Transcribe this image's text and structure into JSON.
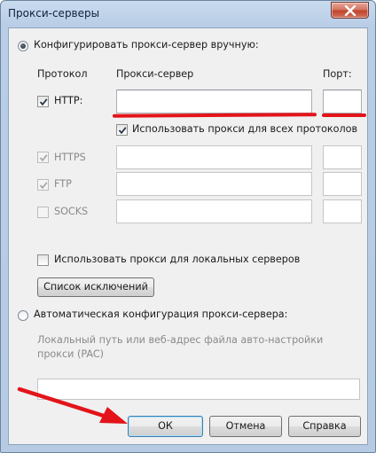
{
  "window": {
    "title": "Прокси-серверы"
  },
  "manual": {
    "radio_label": "Конфигурировать прокси-сервер вручную:",
    "headers": {
      "protocol": "Протокол",
      "server": "Прокси-сервер",
      "port": "Порт:"
    },
    "rows": [
      {
        "label": "HTTP:",
        "checked": true,
        "enabled": true,
        "server": "",
        "port": ""
      },
      {
        "label": "HTTPS",
        "checked": true,
        "enabled": false,
        "server": "",
        "port": ""
      },
      {
        "label": "FTP",
        "checked": true,
        "enabled": false,
        "server": "",
        "port": ""
      },
      {
        "label": "SOCKS",
        "checked": false,
        "enabled": false,
        "server": "",
        "port": ""
      }
    ],
    "use_for_all_label": "Использовать прокси для всех протоколов",
    "use_for_local_label": "Использовать прокси для локальных серверов",
    "exceptions_button": "Список исключений"
  },
  "auto": {
    "radio_label": "Автоматическая конфигурация прокси-сервера:",
    "description": "Локальный путь или веб-адрес файла авто-настройки прокси (PAC)",
    "value": ""
  },
  "buttons": {
    "ok": "ОК",
    "cancel": "Отмена",
    "help": "Справка"
  },
  "colors": {
    "annotation_red": "#e3141a",
    "window_frame": "#b9cde6",
    "dialog_background": "#f0f0f0"
  }
}
